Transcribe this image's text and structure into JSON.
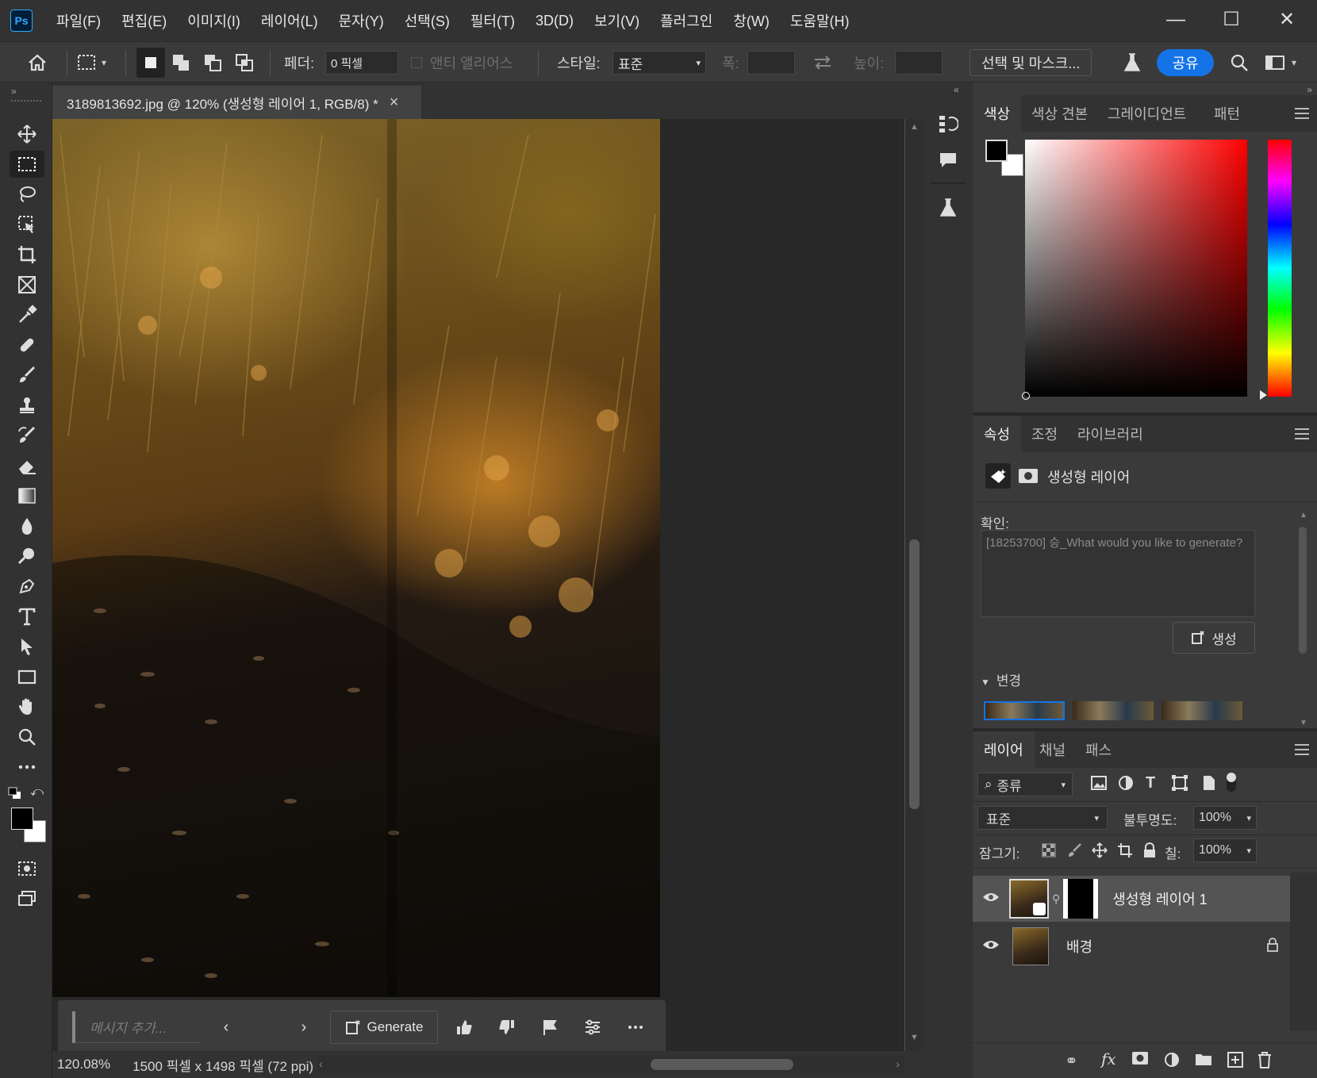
{
  "app": {
    "logo": "Ps",
    "menu": [
      "파일(F)",
      "편집(E)",
      "이미지(I)",
      "레이어(L)",
      "문자(Y)",
      "선택(S)",
      "필터(T)",
      "3D(D)",
      "보기(V)",
      "플러그인",
      "창(W)",
      "도움말(H)"
    ],
    "window_controls": {
      "minimize": "—",
      "maximize": "☐",
      "close": "✕"
    }
  },
  "options": {
    "feather_label": "페더:",
    "feather_value": "0 픽셀",
    "antialias_label": "앤티 앨리어스",
    "style_label": "스타일:",
    "style_value": "표준",
    "width_label": "폭:",
    "height_label": "높이:",
    "select_mask_label": "선택 및 마스크...",
    "share_label": "공유"
  },
  "document": {
    "tab_title": "3189813692.jpg @ 120% (생성형 레이어 1, RGB/8) *",
    "tab_close": "×",
    "zoom": "120.08%",
    "info": "1500 픽셀 x 1498 픽셀 (72 ppi)"
  },
  "genbar": {
    "placeholder": "메시지 추가...",
    "generate_label": "Generate"
  },
  "color_panel": {
    "tabs": [
      "색상",
      "색상 견본",
      "그레이디언트",
      "패턴"
    ],
    "foreground": "#000000",
    "background": "#ffffff"
  },
  "properties_panel": {
    "tabs": [
      "속성",
      "조정",
      "라이브러리"
    ],
    "layer_type": "생성형 레이어",
    "prompt_label": "확인:",
    "prompt_placeholder": "[18253700] 승_What would you like to generate?",
    "generate_button": "생성",
    "variations_label": "변경"
  },
  "layers_panel": {
    "tabs": [
      "레이어",
      "채널",
      "패스"
    ],
    "filter_label": "종류",
    "blend_mode": "표준",
    "opacity_label": "불투명도:",
    "opacity_value": "100%",
    "lock_label": "잠그기:",
    "fill_label": "칠:",
    "fill_value": "100%",
    "layers": [
      {
        "name": "생성형 레이어 1",
        "selected": true
      },
      {
        "name": "배경",
        "selected": false,
        "locked": true
      }
    ]
  },
  "accent_color": "#1473e6"
}
